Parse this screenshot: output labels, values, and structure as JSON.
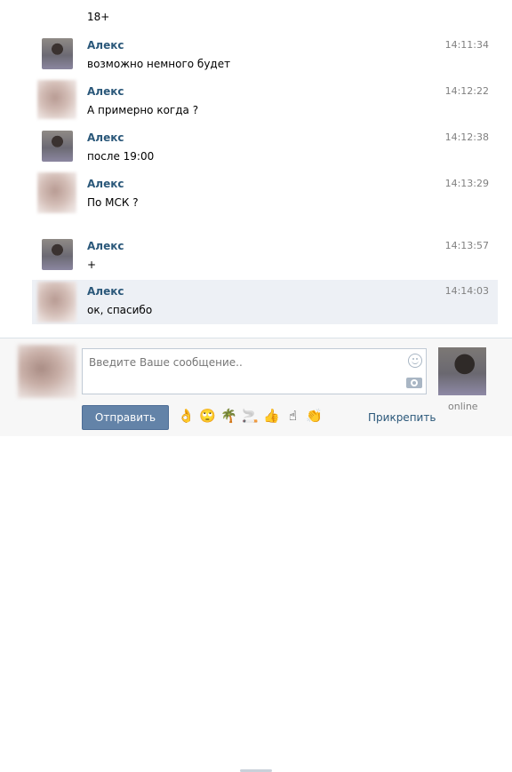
{
  "history": {
    "top_text": "18+",
    "messages": [
      {
        "author": "Алекс",
        "time": "14:11:34",
        "text": "возможно немного будет",
        "avatar": "real"
      },
      {
        "author": "Алекс",
        "time": "14:12:22",
        "text": "А примерно когда ?",
        "avatar": "blurred"
      },
      {
        "author": "Алекс",
        "time": "14:12:38",
        "text": "после 19:00",
        "avatar": "real"
      },
      {
        "author": "Алекс",
        "time": "14:13:29",
        "text": "По МСК ?",
        "avatar": "blurred"
      },
      {
        "author": "Алекс",
        "time": "14:13:57",
        "text": "+",
        "avatar": "real"
      },
      {
        "author": "Алекс",
        "time": "14:14:03",
        "text": "ок, спасибо",
        "avatar": "blurred",
        "highlighted": true
      }
    ]
  },
  "composer": {
    "placeholder": "Введите Ваше сообщение..",
    "send_label": "Отправить",
    "attach_label": "Прикрепить",
    "peer_status": "online",
    "emojis": [
      {
        "name": "ok-hand-emoji",
        "glyph": "👌"
      },
      {
        "name": "rolling-eyes-emoji",
        "glyph": "🙄"
      },
      {
        "name": "palm-tree-emoji",
        "glyph": "🌴"
      },
      {
        "name": "cigarette-emoji",
        "glyph": "🚬"
      },
      {
        "name": "thumbs-up-emoji",
        "glyph": "👍"
      },
      {
        "name": "pointing-up-emoji",
        "glyph": "☝"
      },
      {
        "name": "clapping-hands-emoji",
        "glyph": "👏"
      }
    ]
  },
  "colors": {
    "author": "#2b587a",
    "time": "#808080",
    "highlight_row": "#edf0f5",
    "send_button": "#6383a8",
    "link": "#2b587a"
  }
}
